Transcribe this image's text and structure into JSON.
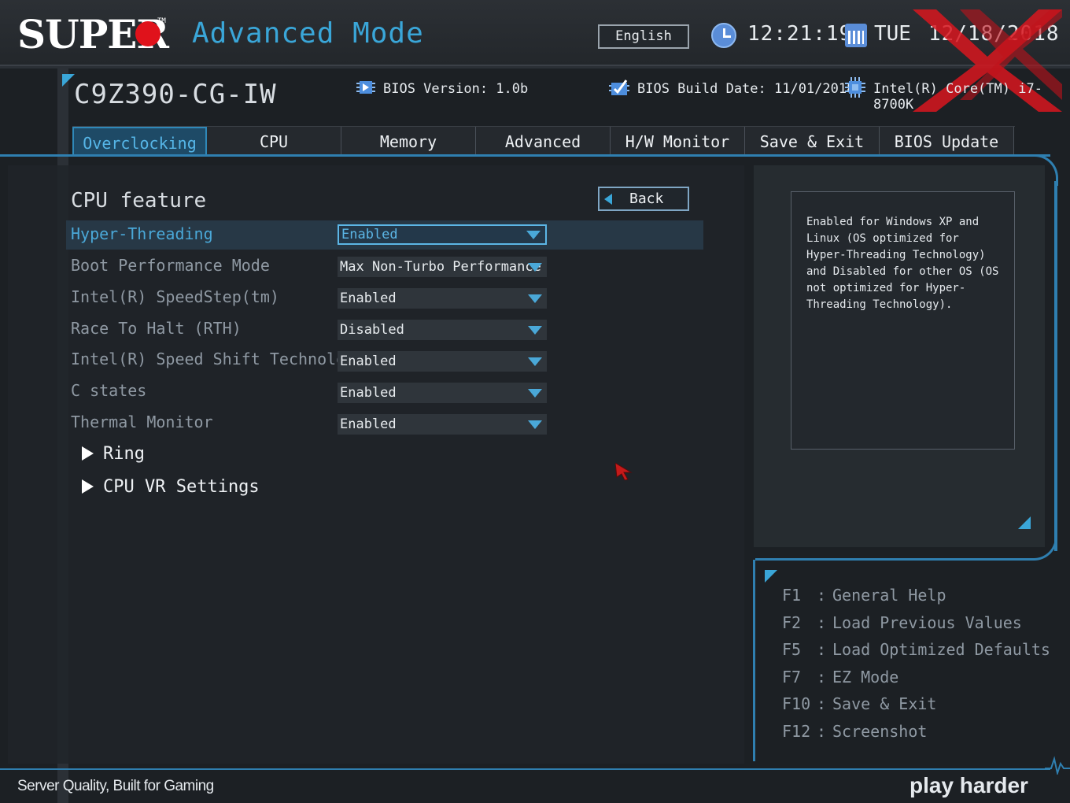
{
  "header": {
    "brand": "SUPER",
    "brand_tm": "TM",
    "mode": "Advanced Mode",
    "language": "English",
    "time": "12:21:19",
    "day": "TUE",
    "date": "12/18/2018"
  },
  "sysinfo": {
    "model": "C9Z390-CG-IW",
    "bios_version": "BIOS Version: 1.0b",
    "bios_build_date": "BIOS Build Date: 11/01/2018",
    "cpu": "Intel(R) Core(TM) i7-8700K"
  },
  "tabs": [
    {
      "label": "Overclocking",
      "active": true
    },
    {
      "label": "CPU"
    },
    {
      "label": "Memory"
    },
    {
      "label": "Advanced"
    },
    {
      "label": "H/W Monitor"
    },
    {
      "label": "Save & Exit"
    },
    {
      "label": "BIOS Update"
    }
  ],
  "page": {
    "title": "CPU feature",
    "back_label": "Back",
    "options": [
      {
        "label": "Hyper-Threading",
        "value": "Enabled"
      },
      {
        "label": "Boot Performance Mode",
        "value": "Max Non-Turbo Performance"
      },
      {
        "label": "Intel(R) SpeedStep(tm)",
        "value": "Enabled"
      },
      {
        "label": "Race To Halt (RTH)",
        "value": "Disabled"
      },
      {
        "label": "Intel(R) Speed Shift Technology",
        "value": "Enabled"
      },
      {
        "label": "C states",
        "value": "Enabled"
      },
      {
        "label": "Thermal Monitor",
        "value": "Enabled"
      }
    ],
    "submenus": [
      "Ring",
      "CPU VR Settings"
    ]
  },
  "help": {
    "text": "Enabled for Windows XP and Linux (OS optimized for Hyper-Threading Technology) and Disabled for other OS (OS not optimized for Hyper-Threading Technology)."
  },
  "hotkeys": [
    {
      "key": "F1",
      "desc": "General Help"
    },
    {
      "key": "F2",
      "desc": "Load Previous Values"
    },
    {
      "key": "F5",
      "desc": "Load Optimized Defaults"
    },
    {
      "key": "F7",
      "desc": "EZ Mode"
    },
    {
      "key": "F10",
      "desc": "Save & Exit"
    },
    {
      "key": "F12",
      "desc": "Screenshot"
    }
  ],
  "footer": {
    "tagline": "Server Quality, Built for Gaming",
    "slogan": "play harder"
  },
  "colors": {
    "accent": "#3aa6d8",
    "brand_red": "#e0121b",
    "highlight_row": "#273846"
  }
}
